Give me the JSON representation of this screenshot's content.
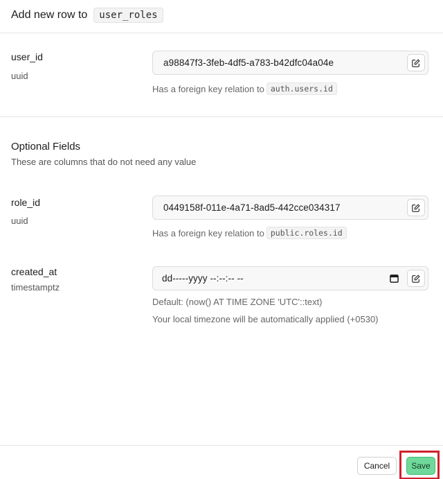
{
  "header": {
    "title": "Add new row to",
    "table_name": "user_roles"
  },
  "required_fields": [
    {
      "name": "user_id",
      "type": "uuid",
      "value": "a98847f3-3feb-4df5-a783-b42dfc04a04e",
      "helper_text": "Has a foreign key relation to",
      "relation": "auth.users.id"
    }
  ],
  "optional_section": {
    "title": "Optional Fields",
    "subtitle": "These are columns that do not need any value"
  },
  "optional_fields": [
    {
      "name": "role_id",
      "type": "uuid",
      "value": "0449158f-011e-4a71-8ad5-442cce034317",
      "helper_text": "Has a foreign key relation to",
      "relation": "public.roles.id"
    },
    {
      "name": "created_at",
      "type": "timestamptz",
      "value": "dd-----yyyy --:--:-- --",
      "default_text": "Default: (now() AT TIME ZONE 'UTC'::text)",
      "timezone_note": "Your local timezone will be automatically applied (+0530)"
    }
  ],
  "footer": {
    "cancel_label": "Cancel",
    "save_label": "Save"
  },
  "icons": {
    "edit": "pencil-square-icon",
    "calendar": "calendar-icon"
  },
  "colors": {
    "save_bg": "#6fd89a",
    "highlight": "#d0202c"
  }
}
